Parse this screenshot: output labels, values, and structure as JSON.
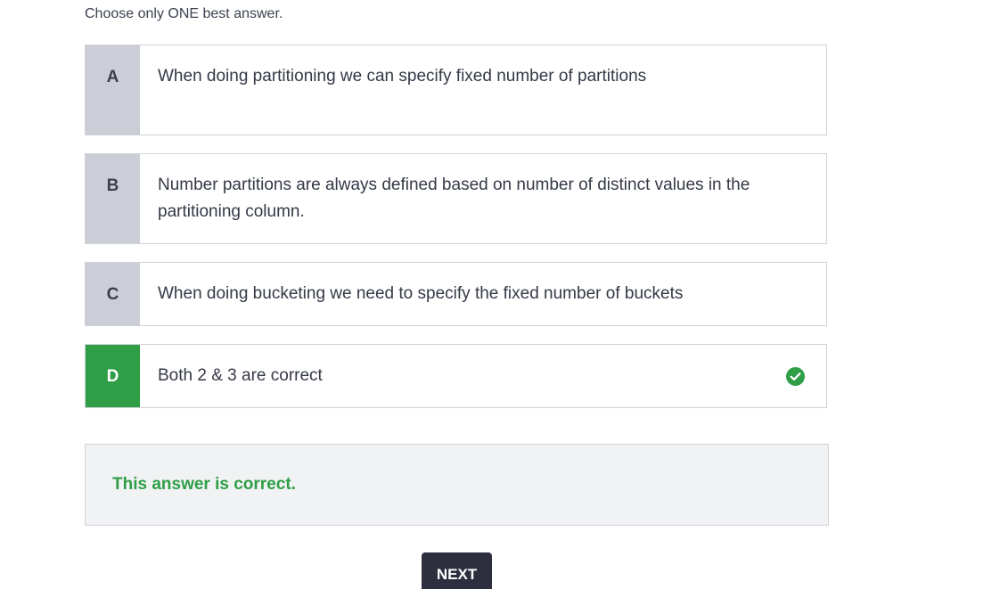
{
  "instruction": "Choose only ONE best answer.",
  "options": [
    {
      "letter": "A",
      "text": "When doing partitioning we can specify fixed number of partitions"
    },
    {
      "letter": "B",
      "text": "Number partitions are always defined based on number of distinct values in the partitioning column."
    },
    {
      "letter": "C",
      "text": "When doing bucketing we need to specify the fixed number of buckets"
    },
    {
      "letter": "D",
      "text": "Both 2 & 3 are correct",
      "selected": true,
      "status_icon": "check-circle-icon"
    }
  ],
  "feedback": {
    "message": "This answer is correct."
  },
  "next_button": {
    "label": "NEXT"
  },
  "colors": {
    "correct": "#2f9e46",
    "letter_bg": "#cbced6",
    "button_bg": "#2d2f3e"
  }
}
